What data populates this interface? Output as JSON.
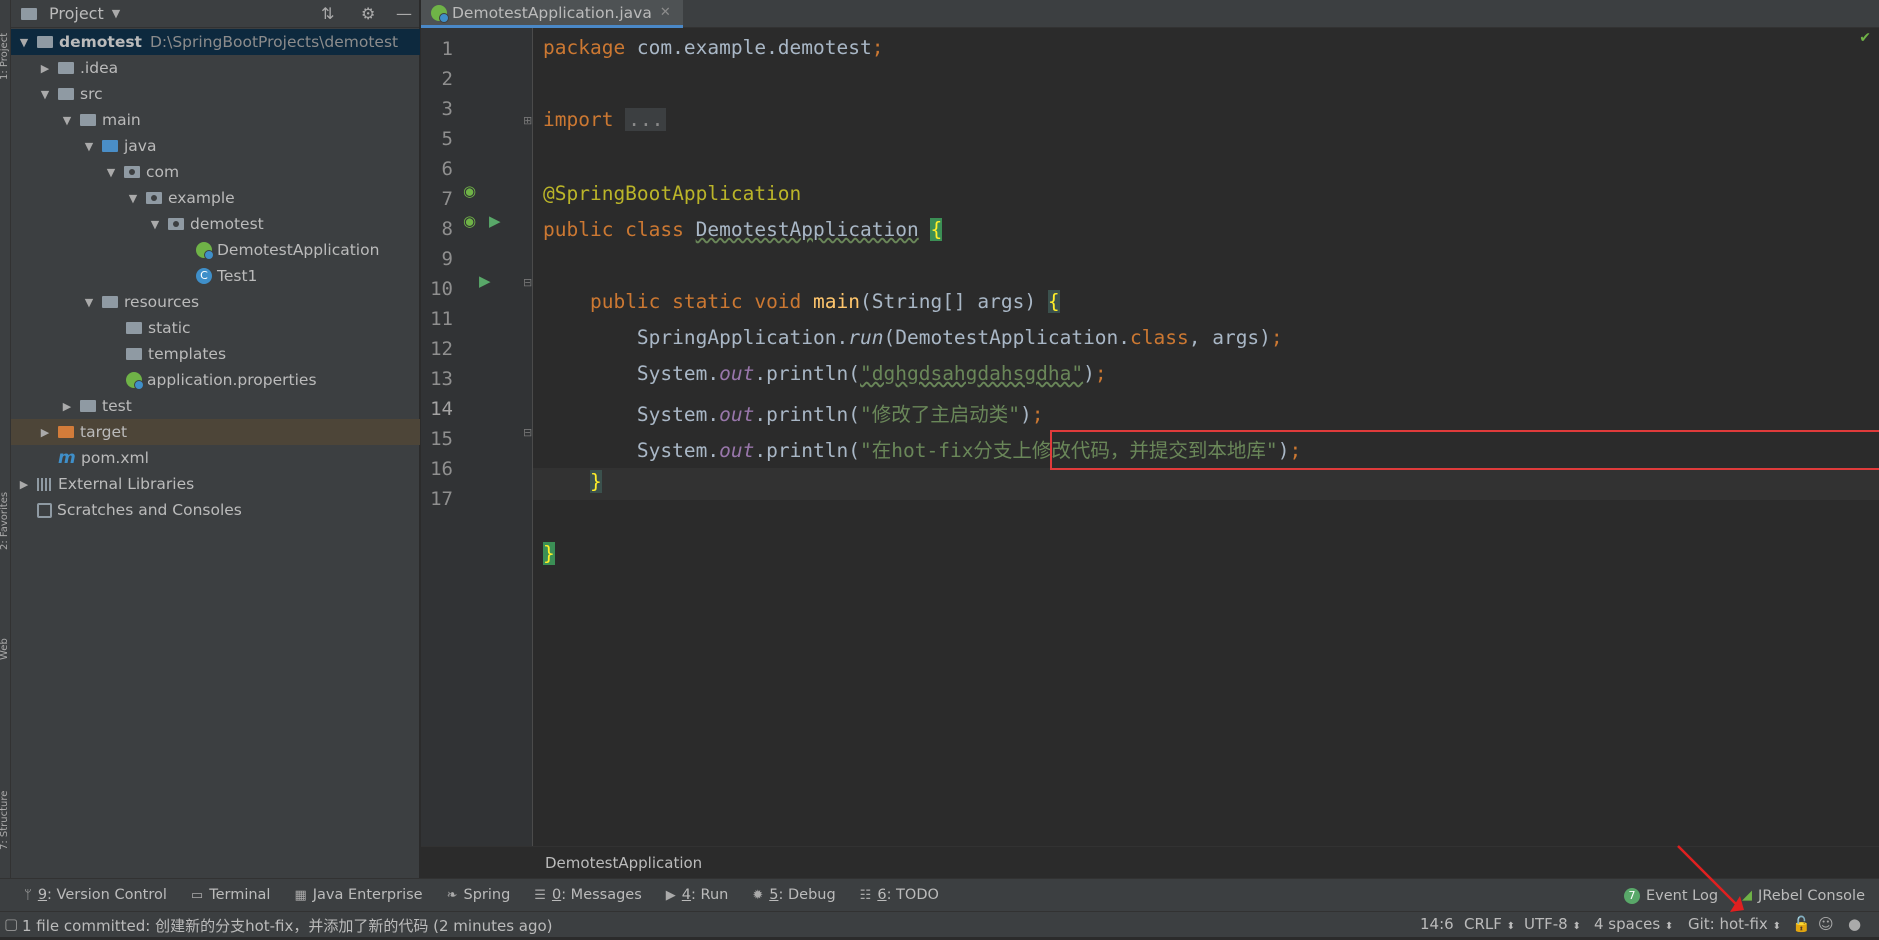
{
  "project_panel": {
    "title": "Project",
    "root_name": "demotest",
    "root_path": "D:\\SpringBootProjects\\demotest",
    "tree": {
      "idea": ".idea",
      "src": "src",
      "main": "main",
      "java": "java",
      "com": "com",
      "example": "example",
      "demotest": "demotest",
      "demotest_app": "DemotestApplication",
      "test1": "Test1",
      "resources": "resources",
      "static": "static",
      "templates": "templates",
      "app_props": "application.properties",
      "test": "test",
      "target": "target",
      "pom": "pom.xml",
      "ext_libs": "External Libraries",
      "scratches": "Scratches and Consoles"
    }
  },
  "editor": {
    "tab_label": "DemotestApplication.java",
    "line_numbers": [
      "1",
      "2",
      "3",
      "5",
      "6",
      "7",
      "8",
      "9",
      "10",
      "11",
      "12",
      "13",
      "14",
      "15",
      "16",
      "17"
    ],
    "lines": {
      "l1_kw": "package",
      "l1_rest": " com.example.demotest",
      "l1_semi": ";",
      "l3_kw": "import",
      "l3_folded": "...",
      "l6_ann": "@SpringBootApplication",
      "l7_kw": "public class",
      "l7_name": "DemotestApplication",
      "l7_brace": "{",
      "l9_kw": "public static void",
      "l9_fn": "main",
      "l9_args": "(String[] args)",
      "l9_brace": "{",
      "l10_a": "SpringApplication.",
      "l10_run": "run",
      "l10_b": "(DemotestApplication.",
      "l10_class": "class",
      "l10_c": ", args)",
      "l10_semi": ";",
      "l11_a": "System.",
      "l11_out": "out",
      "l11_b": ".println(",
      "l11_str": "\"dghgdsahgdahsgdha\"",
      "l11_c": ")",
      "l11_semi": ";",
      "l12_a": "System.",
      "l12_out": "out",
      "l12_b": ".println(",
      "l12_str": "\"修改了主启动类\"",
      "l12_c": ")",
      "l12_semi": ";",
      "l13_a": "System.",
      "l13_out": "out",
      "l13_b": ".println(",
      "l13_str": "\"在hot-fix分支上修改代码，并提交到本地库\"",
      "l13_c": ")",
      "l13_semi": ";",
      "l14_brace": "}",
      "l16_brace": "}"
    },
    "breadcrumb": "DemotestApplication"
  },
  "bottom_tabs": [
    {
      "num": "9",
      "label": ": Version Control"
    },
    {
      "num": "",
      "label": "Terminal"
    },
    {
      "num": "",
      "label": "Java Enterprise"
    },
    {
      "num": "",
      "label": "Spring"
    },
    {
      "num": "0",
      "label": ": Messages"
    },
    {
      "num": "4",
      "label": ": Run"
    },
    {
      "num": "5",
      "label": ": Debug"
    },
    {
      "num": "6",
      "label": ": TODO"
    }
  ],
  "right_tabs": {
    "event_log_badge": "7",
    "event_log": "Event Log",
    "jrebel": "JRebel Console"
  },
  "status": {
    "message": "1 file committed: 创建新的分支hot-fix，并添加了新的代码 (2 minutes ago)",
    "position": "14:6",
    "line_sep": "CRLF",
    "encoding": "UTF-8",
    "indent": "4 spaces",
    "git": "Git: hot-fix"
  },
  "colors": {
    "keyword": "#cc7832",
    "annotation": "#bbb529",
    "string": "#6a8759",
    "highlight_box": "#e03b3b"
  }
}
